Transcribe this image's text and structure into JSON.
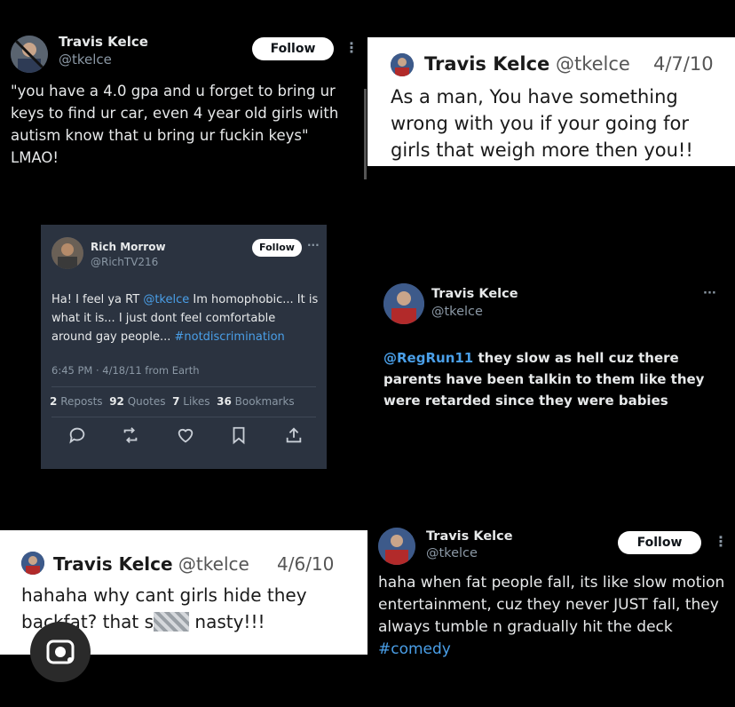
{
  "tweet1": {
    "name": "Travis Kelce",
    "handle": "@tkelce",
    "follow_label": "Follow",
    "more": "⋮",
    "text": "\"you have a 4.0 gpa and u forget to bring ur keys to find ur car, even 4 year old girls with autism know that u bring ur fuckin keys\" LMAO!"
  },
  "tweet2": {
    "name": "Travis Kelce",
    "handle": "@tkelce",
    "date": "4/7/10",
    "text": "As a man, You have something wrong with you if your going for girls that weigh more then you!!"
  },
  "tweet3": {
    "name": "Rich Morrow",
    "handle": "@RichTV216",
    "follow_label": "Follow",
    "more": "···",
    "text_a": "Ha! I feel ya RT ",
    "mention": "@tkelce",
    "text_b": " Im homophobic... It is what it is... I just dont feel comfortable around gay people... ",
    "hashtag": "#notdiscrimination",
    "meta": "6:45 PM · 4/18/11 from Earth",
    "stats": {
      "reposts_n": "2",
      "reposts_l": "Reposts",
      "quotes_n": "92",
      "quotes_l": "Quotes",
      "likes_n": "7",
      "likes_l": "Likes",
      "bookmarks_n": "36",
      "bookmarks_l": "Bookmarks"
    }
  },
  "tweet4": {
    "name": "Travis Kelce",
    "handle": "@tkelce",
    "more": "···",
    "mention": "@RegRun11",
    "text": " they slow as hell cuz there parents have been talkin to them like they were retarded since they were babies"
  },
  "tweet5": {
    "name": "Travis Kelce",
    "handle": "@tkelce",
    "date": "4/6/10",
    "text_a": "hahaha why cant girls hide they backfat? that s",
    "text_b": " nasty!!!"
  },
  "tweet6": {
    "name": "Travis Kelce",
    "handle": "@tkelce",
    "follow_label": "Follow",
    "more": "⋮",
    "text": "haha when fat people fall, its like slow motion entertainment, cuz they never JUST fall, they always tumble n gradually hit the deck ",
    "hashtag": "#comedy"
  },
  "colors": {
    "background": "#000000",
    "link": "#4a9fe8",
    "dark_card": "#2b3340",
    "white_card": "#ffffff"
  },
  "icons": [
    "reply-icon",
    "repost-icon",
    "like-icon",
    "bookmark-icon",
    "share-icon",
    "lens-icon"
  ]
}
